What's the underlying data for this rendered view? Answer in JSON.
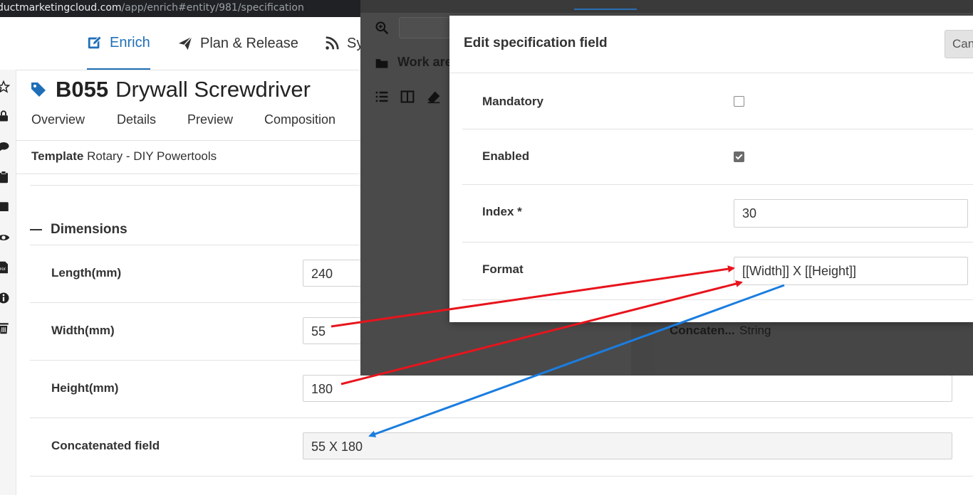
{
  "browser": {
    "url_host": "ductmarketingcloud.com",
    "url_path": "/app/enrich#entity/981/specification"
  },
  "topnav": {
    "items": [
      {
        "label": "Enrich",
        "icon": "edit-icon",
        "active": true
      },
      {
        "label": "Plan & Release",
        "icon": "paper-plane-icon",
        "active": false
      },
      {
        "label": "Sy",
        "icon": "rss-icon",
        "active": false
      }
    ]
  },
  "rail": {
    "icons": [
      "star-icon",
      "lock-icon",
      "comment-icon",
      "clipboard-icon",
      "book-icon",
      "eye-icon",
      "pdf-icon",
      "info-icon",
      "trash-icon"
    ]
  },
  "product": {
    "code": "B055",
    "name": "Drywall Screwdriver",
    "tabs": [
      "Overview",
      "Details",
      "Preview",
      "Composition"
    ],
    "template_label": "Template",
    "template_value": "Rotary - DIY Powertools"
  },
  "section": {
    "title": "Dimensions",
    "fields": [
      {
        "label": "Length(mm)",
        "value": "240"
      },
      {
        "label": "Width(mm)",
        "value": "55"
      },
      {
        "label": "Height(mm)",
        "value": "180"
      },
      {
        "label": "Concatenated field",
        "value": "55 X 180"
      }
    ]
  },
  "background_panel": {
    "work_area_label": "Work are",
    "concat_label": "Concaten...",
    "concat_type": "String"
  },
  "modal": {
    "title": "Edit specification field",
    "cancel_label": "Can",
    "mandatory_label": "Mandatory",
    "mandatory_checked": false,
    "enabled_label": "Enabled",
    "enabled_checked": true,
    "index_label": "Index *",
    "index_value": "30",
    "format_label": "Format",
    "format_value": "[[Width]] X [[Height]]"
  },
  "colors": {
    "accent": "#1f6fb8",
    "arrow_red": "#e8141c",
    "arrow_blue": "#1a7de0",
    "dark_panel": "#4a4a4a"
  }
}
